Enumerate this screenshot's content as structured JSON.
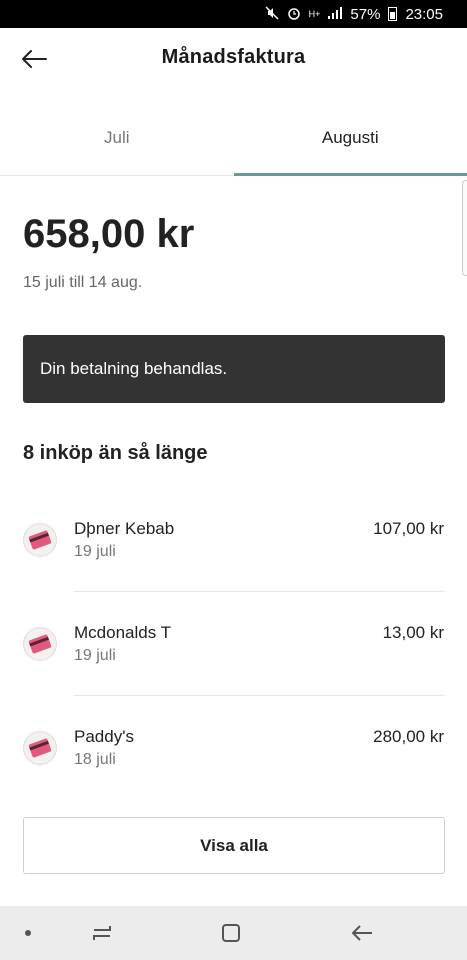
{
  "status_bar": {
    "network": "H+",
    "battery": "57%",
    "time": "23:05"
  },
  "header": {
    "title": "Månadsfaktura",
    "back_icon": "arrow-left-icon"
  },
  "tabs": [
    {
      "label": "Juli",
      "active": false
    },
    {
      "label": "Augusti",
      "active": true
    }
  ],
  "invoice": {
    "amount": "658,00 kr",
    "period": "15 juli till 14 aug.",
    "notice": "Din betalning behandlas."
  },
  "purchases": {
    "heading": "8 inköp än så länge",
    "items": [
      {
        "merchant": "Dþner Kebab",
        "date": "19 juli",
        "amount": "107,00 kr",
        "icon": "credit-card-icon"
      },
      {
        "merchant": "Mcdonalds T",
        "date": "19 juli",
        "amount": "13,00 kr",
        "icon": "credit-card-icon"
      },
      {
        "merchant": "Paddy's",
        "date": "18 juli",
        "amount": "280,00 kr",
        "icon": "credit-card-icon"
      }
    ],
    "show_all_label": "Visa alla"
  },
  "colors": {
    "tab_indicator": "#6a9a97",
    "notice_bg": "#333333",
    "card_icon": "#e05a80"
  }
}
